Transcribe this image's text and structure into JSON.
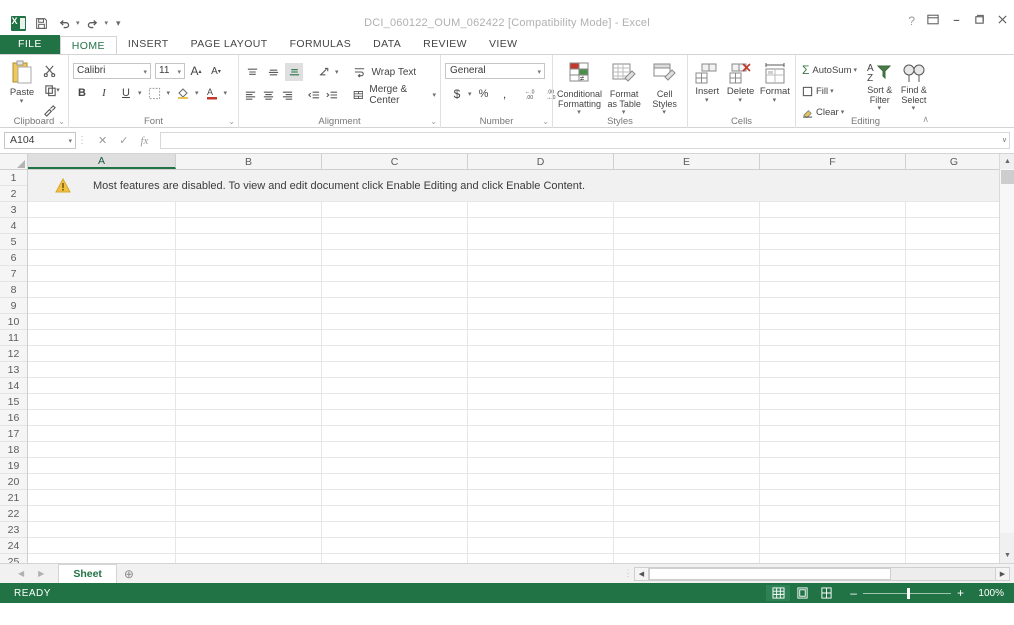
{
  "window": {
    "title": "DCI_060122_OUM_062422  [Compatibility Mode] - Excel",
    "help_label": "?",
    "ribbon_options_label": "▭",
    "minimize_label": "–",
    "restore_label": "❐",
    "close_label": "✕"
  },
  "quick_access": {
    "app_icon": "excel-icon",
    "items": [
      {
        "name": "save-icon",
        "label": "Ὃe"
      },
      {
        "name": "undo-icon",
        "label": "↶"
      },
      {
        "name": "redo-icon",
        "label": "↷"
      },
      {
        "name": "customize-icon",
        "label": "≡"
      }
    ]
  },
  "ribbon": {
    "tabs": [
      {
        "label": "FILE",
        "active": false,
        "file": true
      },
      {
        "label": "HOME",
        "active": true
      },
      {
        "label": "INSERT",
        "active": false
      },
      {
        "label": "PAGE LAYOUT",
        "active": false
      },
      {
        "label": "FORMULAS",
        "active": false
      },
      {
        "label": "DATA",
        "active": false
      },
      {
        "label": "REVIEW",
        "active": false
      },
      {
        "label": "VIEW",
        "active": false
      }
    ],
    "collapse_label": "∧",
    "groups": {
      "clipboard": {
        "label": "Clipboard",
        "paste_label": "Paste",
        "cut_label": "✂",
        "copy_label": "⧉",
        "format_painter_label": "✐"
      },
      "font": {
        "label": "Font",
        "font_name": "Calibri",
        "font_size": "11",
        "grow_font": "A",
        "shrink_font": "A",
        "bold": "B",
        "italic": "I",
        "underline": "U",
        "borders": "▦",
        "fill_color": "△",
        "font_color": "A"
      },
      "alignment": {
        "label": "Alignment",
        "wrap_text": "Wrap Text",
        "merge_center": "Merge & Center",
        "align_top": "≡",
        "align_middle": "≡",
        "align_bottom": "≡",
        "orientation": "⟳",
        "align_left": "≡",
        "align_center": "≡",
        "align_right": "≡",
        "decrease_indent": "⇤",
        "increase_indent": "⇥"
      },
      "number": {
        "label": "Number",
        "format": "General",
        "currency": "$",
        "percent": "%",
        "comma": ",",
        "increase_decimal": ".00",
        "decrease_decimal": ".00"
      },
      "styles": {
        "label": "Styles",
        "conditional_formatting": "Conditional Formatting",
        "format_as_table": "Format as Table",
        "cell_styles": "Cell Styles"
      },
      "cells": {
        "label": "Cells",
        "insert": "Insert",
        "delete": "Delete",
        "format": "Format"
      },
      "editing": {
        "label": "Editing",
        "autosum": "AutoSum",
        "fill": "Fill",
        "clear": "Clear",
        "sort_filter": "Sort & Filter",
        "find_select": "Find & Select"
      }
    }
  },
  "formula_bar": {
    "name_box": "A104",
    "cancel_label": "✕",
    "enter_label": "✓",
    "insert_function_label": "fx",
    "formula_value": "",
    "expand_label": "∨"
  },
  "grid": {
    "columns": [
      "A",
      "B",
      "C",
      "D",
      "E",
      "F",
      "G"
    ],
    "selected_column": "A",
    "rows": [
      1,
      2,
      3,
      4,
      5,
      6,
      7,
      8,
      9,
      10,
      11,
      12,
      13,
      14,
      15,
      16,
      17,
      18,
      19,
      20,
      21,
      22,
      23,
      24,
      25
    ],
    "warning": {
      "icon": "warning-triangle-icon",
      "text": "Most features are disabled. To view and edit document click Enable Editing and click Enable Content."
    }
  },
  "sheet_tabs": {
    "prev_label": "◀",
    "next_label": "▶",
    "tabs": [
      {
        "label": "Sheet",
        "active": true
      }
    ],
    "add_label": "⊕"
  },
  "scrollbars": {
    "v_up": "▲",
    "v_down": "▼",
    "h_left": "◀",
    "h_right": "▶"
  },
  "status_bar": {
    "mode": "READY",
    "views": [
      {
        "name": "normal-view",
        "label": "⌸",
        "active": true
      },
      {
        "name": "page-layout-view",
        "label": "▤",
        "active": false
      },
      {
        "name": "page-break-view",
        "label": "▥",
        "active": false
      }
    ],
    "zoom_out_label": "–",
    "zoom_in_label": "+",
    "zoom_value": "100%"
  },
  "colors": {
    "accent_green": "#217346",
    "title_gray": "#b0b0b0",
    "banner_gray": "#f1f1f1"
  }
}
